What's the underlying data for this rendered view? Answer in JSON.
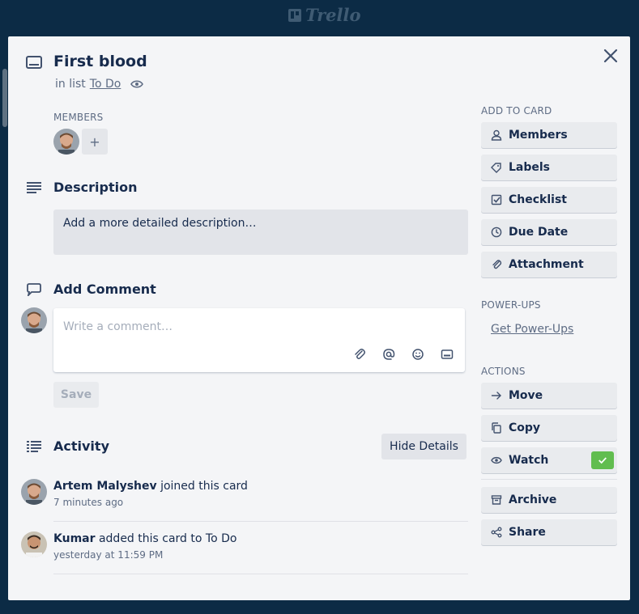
{
  "app": {
    "logo_text": "Trello"
  },
  "card": {
    "title": "First blood",
    "in_list_prefix": "in list",
    "list_name": "To Do"
  },
  "members": {
    "label": "MEMBERS",
    "add_symbol": "+"
  },
  "description": {
    "title": "Description",
    "placeholder": "Add a more detailed description…"
  },
  "comment": {
    "title": "Add Comment",
    "placeholder": "Write a comment…",
    "save_label": "Save"
  },
  "activity": {
    "title": "Activity",
    "hide_details_label": "Hide Details",
    "items": [
      {
        "user": "Artem Malyshev",
        "action": "joined this card",
        "time": "7 minutes ago"
      },
      {
        "user": "Kumar",
        "action": "added this card to To Do",
        "time": "yesterday at 11:59 PM"
      }
    ]
  },
  "sidebar": {
    "add_to_card_label": "ADD TO CARD",
    "add_to_card": [
      "Members",
      "Labels",
      "Checklist",
      "Due Date",
      "Attachment"
    ],
    "powerups_label": "POWER-UPS",
    "get_powerups": "Get Power-Ups",
    "actions_label": "ACTIONS",
    "actions": [
      "Move",
      "Copy",
      "Watch",
      "Archive",
      "Share"
    ]
  },
  "colors": {
    "board_bg": "#0c2b45",
    "modal_bg": "#f4f5f7",
    "watch_check": "#61bd4f",
    "text": "#172b4d"
  }
}
